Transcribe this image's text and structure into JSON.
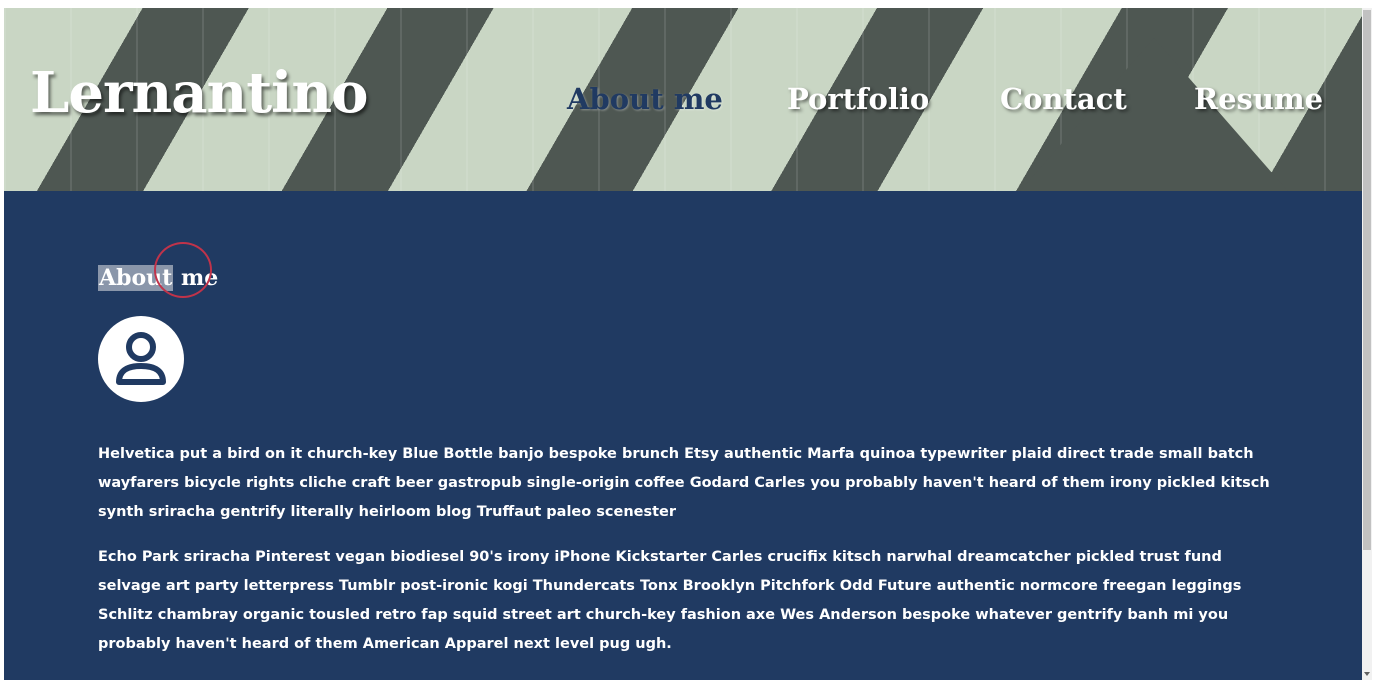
{
  "site": {
    "logo": "Lernantino"
  },
  "nav": {
    "items": [
      {
        "label": "About me",
        "active": true
      },
      {
        "label": "Portfolio",
        "active": false
      },
      {
        "label": "Contact",
        "active": false
      },
      {
        "label": "Resume",
        "active": false
      }
    ]
  },
  "about": {
    "heading_selected": "About",
    "heading_rest": " me",
    "avatar_icon": "user-avatar-icon",
    "paragraphs": [
      "Helvetica put a bird on it church-key Blue Bottle banjo bespoke brunch Etsy authentic Marfa quinoa typewriter plaid direct trade small batch wayfarers bicycle rights cliche craft beer gastropub single-origin coffee Godard Carles you probably haven't heard of them irony pickled kitsch synth sriracha gentrify literally heirloom blog Truffaut paleo scenester",
      "Echo Park sriracha Pinterest vegan biodiesel 90's irony iPhone Kickstarter Carles crucifix kitsch narwhal dreamcatcher pickled trust fund selvage art party letterpress Tumblr post-ironic kogi Thundercats Tonx Brooklyn Pitchfork Odd Future authentic normcore freegan leggings Schlitz chambray organic tousled retro fap squid street art church-key fashion axe Wes Anderson bespoke whatever gentrify banh mi you probably haven't heard of them American Apparel next level pug ugh."
    ]
  },
  "colors": {
    "main_background": "#203a62",
    "header_light_stripe": "#c9d6c4",
    "header_dark_stripe": "#4e5752",
    "text": "#ffffff",
    "click_ring": "#c0334a"
  }
}
